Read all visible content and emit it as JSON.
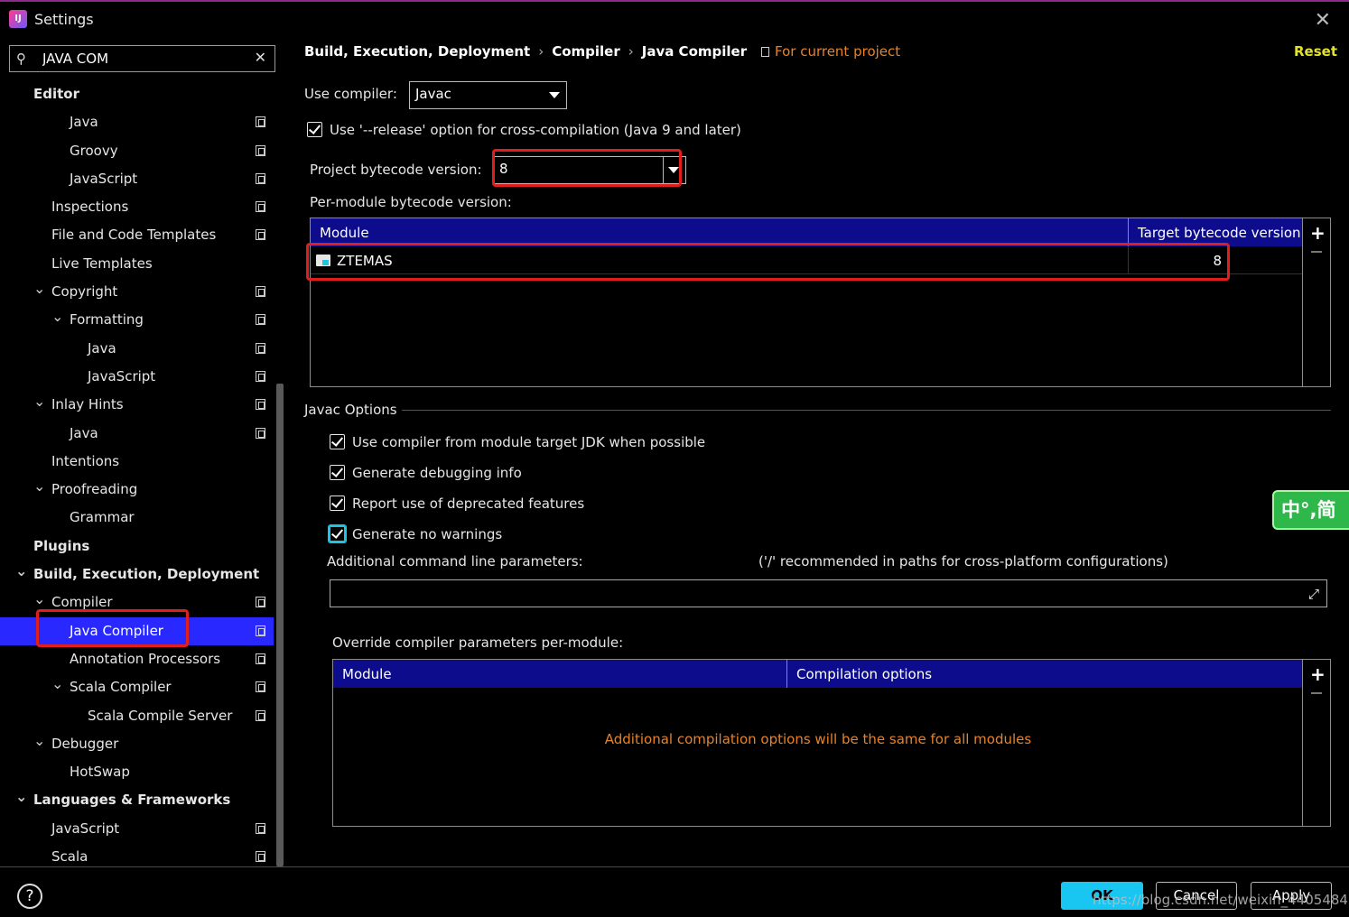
{
  "window": {
    "title": "Settings",
    "close_glyph": "✕"
  },
  "search": {
    "value": "JAVA COM",
    "clear_glyph": "✕",
    "search_glyph": "⚲"
  },
  "sidebar": {
    "items": [
      {
        "label": "Editor",
        "bold": true,
        "copy": false,
        "chev": ""
      },
      {
        "label": "Java",
        "copy": true,
        "chev": ""
      },
      {
        "label": "Groovy",
        "copy": true,
        "chev": ""
      },
      {
        "label": "JavaScript",
        "copy": true,
        "chev": ""
      },
      {
        "label": "Inspections",
        "copy": true,
        "chev": ""
      },
      {
        "label": "File and Code Templates",
        "copy": true,
        "chev": ""
      },
      {
        "label": "Live Templates",
        "copy": false,
        "chev": ""
      },
      {
        "label": "Copyright",
        "copy": true,
        "chev": "﹀"
      },
      {
        "label": "Formatting",
        "copy": true,
        "chev": "﹀"
      },
      {
        "label": "Java",
        "copy": true,
        "chev": ""
      },
      {
        "label": "JavaScript",
        "copy": true,
        "chev": ""
      },
      {
        "label": "Inlay Hints",
        "copy": true,
        "chev": "﹀"
      },
      {
        "label": "Java",
        "copy": true,
        "chev": ""
      },
      {
        "label": "Intentions",
        "copy": false,
        "chev": ""
      },
      {
        "label": "Proofreading",
        "copy": false,
        "chev": "﹀"
      },
      {
        "label": "Grammar",
        "copy": false,
        "chev": ""
      },
      {
        "label": "Plugins",
        "bold": true,
        "copy": false,
        "chev": ""
      },
      {
        "label": "Build, Execution, Deployment",
        "bold": true,
        "copy": false,
        "chev": "﹀"
      },
      {
        "label": "Compiler",
        "copy": true,
        "chev": "﹀"
      },
      {
        "label": "Java Compiler",
        "copy": true,
        "chev": "",
        "selected": true
      },
      {
        "label": "Annotation Processors",
        "copy": true,
        "chev": ""
      },
      {
        "label": "Scala Compiler",
        "copy": true,
        "chev": "﹀"
      },
      {
        "label": "Scala Compile Server",
        "copy": true,
        "chev": ""
      },
      {
        "label": "Debugger",
        "copy": false,
        "chev": "﹀"
      },
      {
        "label": "HotSwap",
        "copy": false,
        "chev": ""
      },
      {
        "label": "Languages & Frameworks",
        "bold": true,
        "copy": false,
        "chev": "﹀"
      },
      {
        "label": "JavaScript",
        "copy": true,
        "chev": ""
      },
      {
        "label": "Scala",
        "copy": true,
        "chev": ""
      }
    ]
  },
  "breadcrumb": {
    "part1": "Build, Execution, Deployment",
    "part2": "Compiler",
    "part3": "Java Compiler",
    "sep": "›"
  },
  "for_project": "For current project",
  "reset": "Reset",
  "use_compiler": {
    "label": "Use compiler:",
    "value": "Javac"
  },
  "release_option": {
    "label": "Use '--release' option for cross-compilation (Java 9 and later)",
    "checked": true
  },
  "project_bytecode": {
    "label": "Project bytecode version:",
    "value": "8"
  },
  "per_module": {
    "label": "Per-module bytecode version:",
    "headers": {
      "module": "Module",
      "target": "Target bytecode version"
    },
    "rows": [
      {
        "module": "ZTEMAS",
        "target": "8"
      }
    ]
  },
  "javac": {
    "title": "Javac Options",
    "options": [
      {
        "label": "Use compiler from module target JDK when possible",
        "checked": true
      },
      {
        "label": "Generate debugging info",
        "checked": true
      },
      {
        "label": "Report use of deprecated features",
        "checked": true
      },
      {
        "label": "Generate no warnings",
        "checked": true
      }
    ],
    "params_label": "Additional command line parameters:",
    "params_hint": "('/' recommended in paths for cross-platform configurations)",
    "params_value": "",
    "expand_glyph": "⤢"
  },
  "override": {
    "label": "Override compiler parameters per-module:",
    "headers": {
      "module": "Module",
      "options": "Compilation options"
    },
    "empty": "Additional compilation options will be the same for all modules"
  },
  "table_tools": {
    "plus": "+",
    "minus": "−"
  },
  "ime_badge": "中°,简",
  "footer": {
    "help": "?",
    "ok": "OK",
    "cancel": "Cancel",
    "apply": "Apply",
    "watermark": "https://blog.csdn.net/weixin_4405484"
  },
  "colors": {
    "accent": "#2828ff",
    "header": "#0c0c8c",
    "link_orange": "#e6822a",
    "reset_yellow": "#e3e32c",
    "highlight_red": "#e01e1e",
    "ok_cyan": "#19c6f2"
  }
}
